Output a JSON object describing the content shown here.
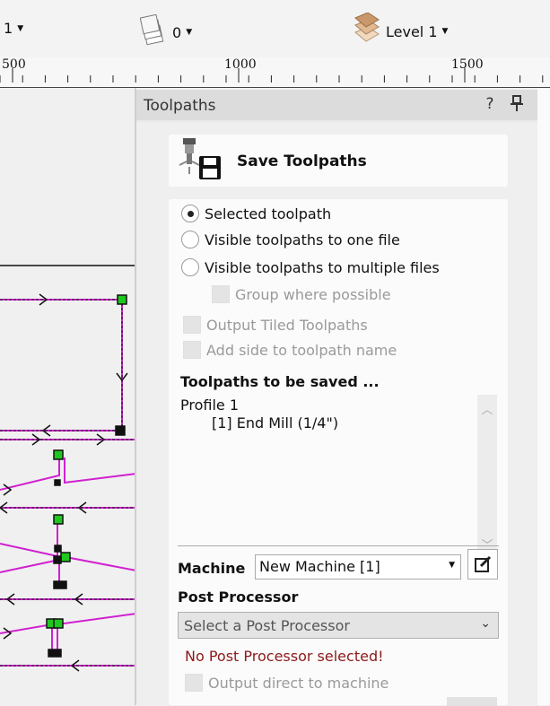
{
  "toolbar": {
    "item1_label": "1",
    "item2_label": "0",
    "item3_label": "Level 1",
    "layers_icon": "layers-icon",
    "level_icon": "level-stack-icon"
  },
  "ruler": {
    "labels": [
      "500",
      "1000",
      "1500"
    ]
  },
  "panel": {
    "title": "Toolpaths",
    "help_label": "?",
    "pin_icon": "pin-icon",
    "save_title": "Save Toolpaths",
    "options": {
      "selected": "Selected toolpath",
      "visible_one": "Visible toolpaths to one file",
      "visible_multiple": "Visible toolpaths to multiple files",
      "group": "Group where possible",
      "output_tiled": "Output Tiled Toolpaths",
      "add_side": "Add side to toolpath name"
    },
    "to_be_saved_title": "Toolpaths to be saved ...",
    "list": {
      "group": "Profile 1",
      "item": "[1] End Mill (1/4\")"
    },
    "machine_label": "Machine",
    "machine_value": "New Machine [1]",
    "post_processor_label": "Post Processor",
    "post_processor_value": "Select a Post Processor",
    "error_text": "No Post Processor selected!",
    "output_direct": "Output direct to machine"
  },
  "colors": {
    "toolpath": "#d020d0",
    "node": "#1ec81e",
    "error": "#8b1a1a"
  }
}
